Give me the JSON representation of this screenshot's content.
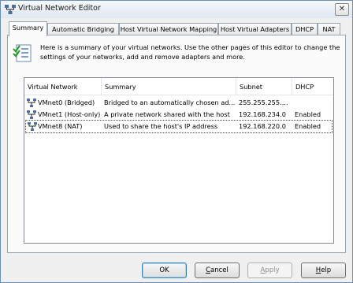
{
  "window": {
    "title": "Virtual Network Editor",
    "close_symbol": "✕"
  },
  "tabs": [
    {
      "label": "Summary",
      "active": true
    },
    {
      "label": "Automatic Bridging",
      "active": false
    },
    {
      "label": "Host Virtual Network Mapping",
      "active": false
    },
    {
      "label": "Host Virtual Adapters",
      "active": false
    },
    {
      "label": "DHCP",
      "active": false
    },
    {
      "label": "NAT",
      "active": false
    }
  ],
  "summary": {
    "intro_line1": "Here is a summary of your virtual networks. Use the other pages of this editor to change the",
    "intro_line2": "settings of your networks, add and remove adapters and more."
  },
  "table": {
    "columns": [
      "Virtual Network",
      "Summary",
      "Subnet",
      "DHCP"
    ],
    "rows": [
      {
        "network": "VMnet0 (Bridged)",
        "summary": "Bridged to an automatically chosen ad...",
        "subnet": "255.255.255....",
        "dhcp": ""
      },
      {
        "network": "VMnet1 (Host-only)",
        "summary": "A private network shared with the host",
        "subnet": "192.168.234.0",
        "dhcp": "Enabled"
      },
      {
        "network": "VMnet8 (NAT)",
        "summary": "Used to share the host's IP address",
        "subnet": "192.168.220.0",
        "dhcp": "Enabled"
      }
    ]
  },
  "buttons": {
    "ok": {
      "label": "OK",
      "mnemonic": ""
    },
    "cancel": {
      "pre": "",
      "mnemonic": "C",
      "post": "ancel"
    },
    "apply": {
      "pre": "",
      "mnemonic": "A",
      "post": "pply",
      "enabled": false
    },
    "help": {
      "pre": "",
      "mnemonic": "H",
      "post": "elp"
    }
  },
  "colors": {
    "title_bg": "#dfe7f1",
    "dialog_bg": "#f0f0f0",
    "focus_border": "#3c7fb1"
  },
  "icons": {
    "title": "network-editor-icon",
    "info": "checklist-icon",
    "row": "network-adapter-icon"
  }
}
